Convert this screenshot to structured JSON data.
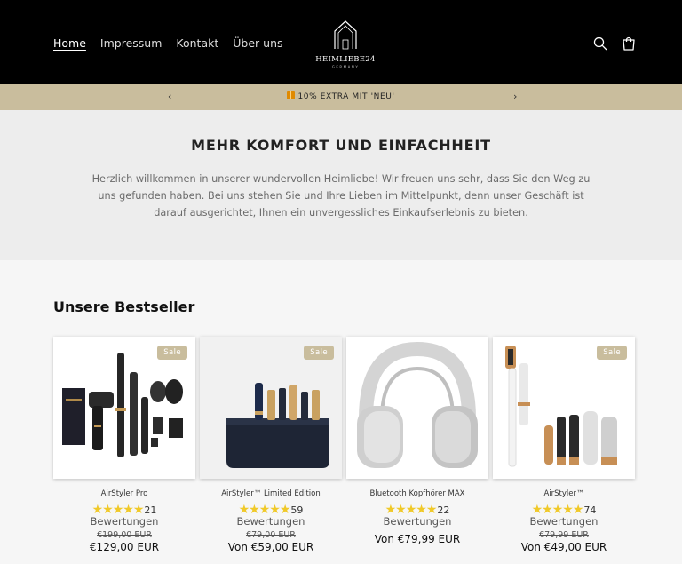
{
  "header": {
    "nav": [
      "Home",
      "Impressum",
      "Kontakt",
      "Über uns"
    ],
    "logo_name": "HEIMLIEBE24",
    "logo_sub": "GERMANY"
  },
  "announcement": {
    "text": "10% EXTRA MIT 'NEU'",
    "prev": "‹",
    "next": "›"
  },
  "intro": {
    "title": "MEHR KOMFORT UND EINFACHHEIT",
    "text": "Herzlich willkommen in unserer wundervollen Heimliebe! Wir freuen uns sehr, dass Sie den Weg zu uns gefunden haben. Bei uns stehen Sie und Ihre Lieben im Mittelpunkt, denn unser Geschäft ist darauf ausgerichtet, Ihnen ein unvergessliches Einkaufserlebnis zu bieten."
  },
  "bestsellers": {
    "title": "Unsere Bestseller",
    "products": [
      {
        "name": "AirStyler Pro",
        "stars": "★★★★★",
        "count": "21",
        "reviews_label": "Bewertungen",
        "badge": "Sale",
        "old_price": "€199,00 EUR",
        "price": "€129,00 EUR"
      },
      {
        "name": "AirStyler™ Limited Edition",
        "stars": "★★★★★",
        "count": "59",
        "reviews_label": "Bewertungen",
        "badge": "Sale",
        "old_price": "€79,00 EUR",
        "price": "Von €59,00 EUR"
      },
      {
        "name": "Bluetooth Kopfhörer MAX",
        "stars": "★★★★★",
        "count": "22",
        "reviews_label": "Bewertungen",
        "badge": "",
        "old_price": "",
        "price": "Von €79,99 EUR"
      },
      {
        "name": "AirStyler™",
        "stars": "★★★★★",
        "count": "74",
        "reviews_label": "Bewertungen",
        "badge": "Sale",
        "old_price": "€79,99 EUR",
        "price": "Von €49,00 EUR"
      }
    ]
  },
  "colors": {
    "header_bg": "#000000",
    "announcement_bg": "#c9bd9d",
    "sale_badge": "#c9bd9d",
    "stars": "#f0c929"
  },
  "icons": [
    "search-icon",
    "cart-icon",
    "gift-icon",
    "home-logo-icon"
  ]
}
